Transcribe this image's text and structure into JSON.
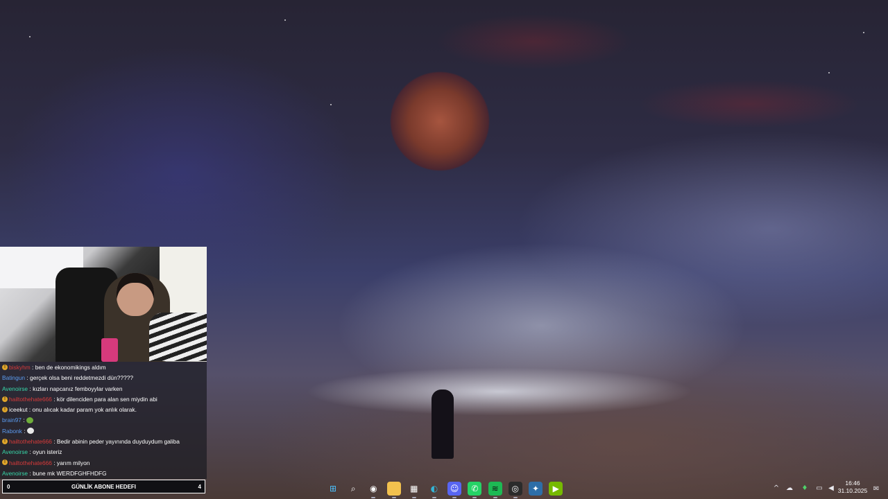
{
  "chat": {
    "messages": [
      {
        "badge": true,
        "user": "biskyhm",
        "user_color": "#d83a3a",
        "text": "ben de ekonomikings aldım"
      },
      {
        "badge": false,
        "user": "Batingun",
        "user_color": "#5b9bf0",
        "text": "gerçek olsa beni reddetmezdi dün?????"
      },
      {
        "badge": false,
        "user": "Avenoirse",
        "user_color": "#37d6a8",
        "text": "kızları napcanız femboyylar varken"
      },
      {
        "badge": true,
        "user": "hailtothehate666",
        "user_color": "#d83a3a",
        "text": "kör dilenciden para alan sen miydin abi"
      },
      {
        "badge": true,
        "user": "iceekut",
        "user_color": "#ffffff",
        "text": "onu alıcak kadar param yok anlık olarak."
      },
      {
        "badge": false,
        "user": "brain97",
        "user_color": "#5b9bf0",
        "text": "",
        "emote": "turtle-emote",
        "emote_color": "#6fae3a"
      },
      {
        "badge": false,
        "user": "Rabonk",
        "user_color": "#5b9bf0",
        "text": "",
        "emote": "hand-emote",
        "emote_color": "#e8e8e8"
      },
      {
        "badge": true,
        "user": "hailtothehate666",
        "user_color": "#d83a3a",
        "text": "Bedir abinin peder yayınında duyduydum galiba"
      },
      {
        "badge": false,
        "user": "Avenoirse",
        "user_color": "#37d6a8",
        "text": "oyun isteriz"
      },
      {
        "badge": true,
        "user": "hailtothehate666",
        "user_color": "#d83a3a",
        "text": "yarım milyon"
      },
      {
        "badge": false,
        "user": "Avenoirse",
        "user_color": "#37d6a8",
        "text": "bune mk WERDFGHFHDFG"
      }
    ]
  },
  "goal": {
    "left": "0",
    "title": "GÜNLİK ABONE HEDEFI",
    "right": "4"
  },
  "taskbar": {
    "apps": [
      {
        "name": "start-icon",
        "glyph": "⊞",
        "bg": "transparent",
        "color": "#4cc2ff"
      },
      {
        "name": "search-icon",
        "glyph": "⌕",
        "bg": "transparent",
        "color": "#ffffff"
      },
      {
        "name": "steam-icon",
        "glyph": "◉",
        "bg": "transparent",
        "color": "#ffffff"
      },
      {
        "name": "file-explorer-icon",
        "glyph": "▬",
        "bg": "#f2c14e",
        "color": "#f2c14e"
      },
      {
        "name": "microsoft-store-icon",
        "glyph": "▦",
        "bg": "transparent",
        "color": "#ffffff"
      },
      {
        "name": "edge-icon",
        "glyph": "◐",
        "bg": "transparent",
        "color": "#33b6d8"
      },
      {
        "name": "discord-icon",
        "glyph": "☺",
        "bg": "#5865f2",
        "color": "#ffffff"
      },
      {
        "name": "whatsapp-icon",
        "glyph": "✆",
        "bg": "#25d366",
        "color": "#ffffff"
      },
      {
        "name": "spotify-icon",
        "glyph": "≋",
        "bg": "#1db954",
        "color": "#111111"
      },
      {
        "name": "obs-icon",
        "glyph": "◎",
        "bg": "#2b2b2b",
        "color": "#ffffff"
      },
      {
        "name": "app-icon",
        "glyph": "✦",
        "bg": "#2d6ea8",
        "color": "#ffffff"
      },
      {
        "name": "nvidia-icon",
        "glyph": "▶",
        "bg": "#76b900",
        "color": "#ffffff"
      }
    ],
    "tray": [
      {
        "name": "chevron-up-icon",
        "glyph": "^"
      },
      {
        "name": "cloud-icon",
        "glyph": "☁"
      },
      {
        "name": "microphone-icon",
        "glyph": "♦"
      },
      {
        "name": "network-icon",
        "glyph": "▭"
      },
      {
        "name": "volume-icon",
        "glyph": "◀"
      }
    ],
    "time": "16:46",
    "date": "31.10.2025",
    "notification_glyph": "✉"
  }
}
